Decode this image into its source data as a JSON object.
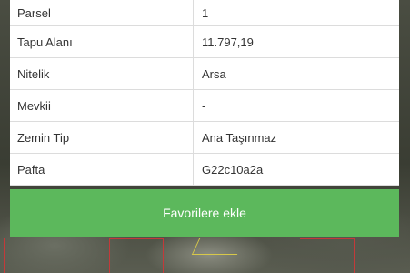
{
  "details": {
    "rows": [
      {
        "label": "Parsel",
        "value": "1"
      },
      {
        "label": "Tapu Alanı",
        "value": "11.797,19"
      },
      {
        "label": "Nitelik",
        "value": "Arsa"
      },
      {
        "label": "Mevkii",
        "value": "-"
      },
      {
        "label": "Zemin Tip",
        "value": "Ana Taşınmaz"
      },
      {
        "label": "Pafta",
        "value": "G22c10a2a"
      }
    ]
  },
  "actions": {
    "favorite_label": "Favorilere ekle"
  },
  "colors": {
    "button_green": "#5cb85c",
    "parcel_outline": "#c33a3a",
    "highlight_outline": "#d7c84a"
  }
}
